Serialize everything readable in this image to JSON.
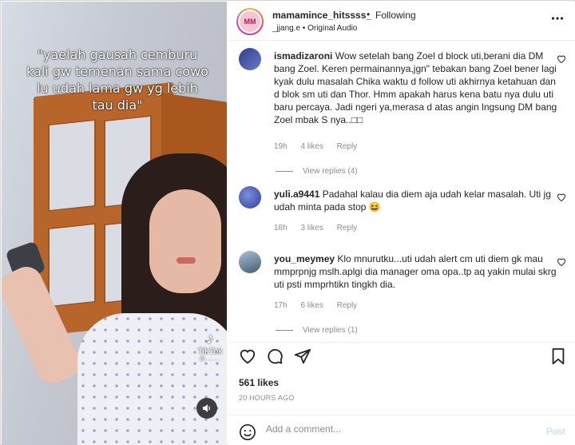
{
  "video": {
    "caption": "\"yaelah gausah cemburu kali gw temenan sama cowo lu udah lama gw yg lebih tau dia\"",
    "watermark": "TikTok",
    "watermark_handle": "@..........",
    "mute_icon": "speaker-icon"
  },
  "header": {
    "username": "mamamince_hitssss_",
    "separator": "•",
    "follow_status": "Following",
    "audio_line": "_jjang.e • Original Audio",
    "more_icon": "more-options-icon"
  },
  "comments": [
    {
      "username": "ismadizaroni",
      "text": "Wow setelah bang Zoel d block uti,berani dia DM bang Zoel. Keren permainannya,jgn\" tebakan bang Zoel bener lagi kyak dulu masalah Chika waktu d follow uti akhirnya ketahuan dan d blok sm uti dan Thor. Hmm apakah harus kena batu nya dulu uti baru percaya. Jadi ngeri ya,merasa d atas angin lngsung DM bang Zoel mbak S nya..□□",
      "age": "19h",
      "likes": "4 likes",
      "reply_label": "Reply",
      "view_replies": "View replies (4)",
      "avatar_color": "#4a5aa8"
    },
    {
      "username": "yuli.a9441",
      "text": "Padahal kalau dia diem aja udah kelar masalah. Uti jg udah minta pada stop 😆",
      "age": "18h",
      "likes": "3 likes",
      "reply_label": "Reply",
      "avatar_color": "#3b5bbf"
    },
    {
      "username": "you_meymey",
      "text": "Klo mnurutku...uti udah alert cm uti diem gk mau mmprpnjg mslh.aplgi dia manager oma opa..tp aq yakin mulai skrg uti psti mmprhtikn tingkh dia.",
      "age": "17h",
      "likes": "6 likes",
      "reply_label": "Reply",
      "view_replies": "View replies (1)",
      "avatar_color": "#5f7d94"
    }
  ],
  "actions": {
    "like_icon": "heart-icon",
    "comment_icon": "comment-icon",
    "share_icon": "share-icon",
    "save_icon": "bookmark-icon"
  },
  "post_stats": {
    "likes": "561 likes",
    "timestamp": "20 HOURS AGO"
  },
  "add_comment": {
    "placeholder": "Add a comment...",
    "post_label": "Post",
    "emoji_icon": "emoji-icon"
  },
  "colors": {
    "text": "#262626",
    "muted": "#8e8e8e",
    "post_disabled": "#b3dbff"
  }
}
